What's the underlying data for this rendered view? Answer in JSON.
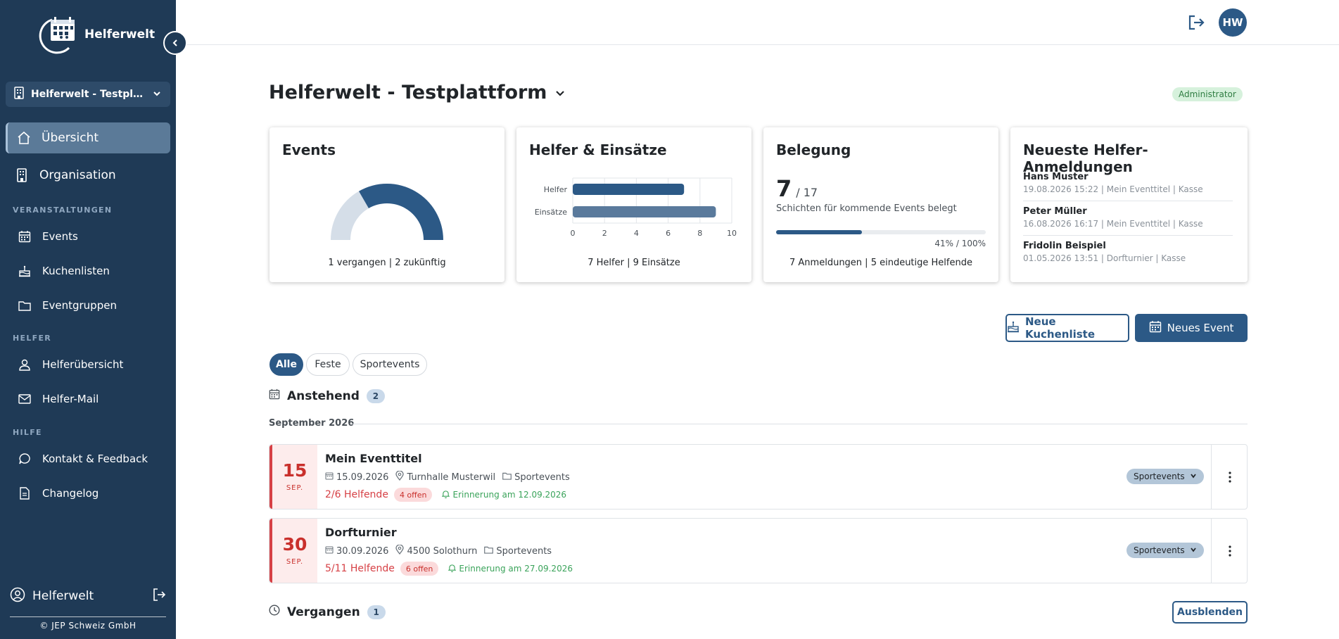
{
  "app": {
    "brand": "Helferwelt",
    "org_name": "Helferwelt - Testplatt...",
    "copyright": "© JEP Schweiz GmbH"
  },
  "sidebar": {
    "main": [
      {
        "label": "Übersicht",
        "icon": "home-icon"
      },
      {
        "label": "Organisation",
        "icon": "building-icon"
      }
    ],
    "sections": [
      {
        "title": "VERANSTALTUNGEN",
        "items": [
          {
            "label": "Events",
            "icon": "calendar-icon"
          },
          {
            "label": "Kuchenlisten",
            "icon": "cake-icon"
          },
          {
            "label": "Eventgruppen",
            "icon": "folder-icon"
          }
        ]
      },
      {
        "title": "HELFER",
        "items": [
          {
            "label": "Helferübersicht",
            "icon": "user-icon"
          },
          {
            "label": "Helfer-Mail",
            "icon": "mail-icon"
          }
        ]
      },
      {
        "title": "HILFE",
        "items": [
          {
            "label": "Kontakt & Feedback",
            "icon": "chat-icon"
          },
          {
            "label": "Changelog",
            "icon": "document-icon"
          }
        ]
      }
    ],
    "footer_user": "Helferwelt"
  },
  "topbar": {
    "avatar_initials": "HW"
  },
  "page": {
    "title": "Helferwelt - Testplattform",
    "role": "Administrator"
  },
  "cards": {
    "events": {
      "title": "Events",
      "footer": "1 vergangen | 2 zukünftig",
      "chart_data": {
        "type": "pie",
        "categories": [
          "vergangen",
          "zukünftig"
        ],
        "values": [
          1,
          2
        ]
      }
    },
    "helpers": {
      "title": "Helfer & Einsätze",
      "footer": "7 Helfer | 9 Einsätze",
      "chart_data": {
        "type": "bar",
        "orientation": "horizontal",
        "categories": [
          "Helfer",
          "Einsätze"
        ],
        "values": [
          7,
          9
        ],
        "xlim": [
          0,
          10
        ],
        "ticks": [
          "0",
          "2",
          "4",
          "6",
          "8",
          "10"
        ],
        "colors": [
          "#2c5986",
          "#5a7a9c"
        ],
        "grid": true
      }
    },
    "occupancy": {
      "title": "Belegung",
      "filled": "7",
      "total": "/ 17",
      "subtitle": "Schichten für kommende Events belegt",
      "percent_label": "41% / 100%",
      "percent": 41,
      "footer": "7 Anmeldungen | 5 eindeutige Helfende"
    },
    "registrations": {
      "title": "Neueste Helfer-Anmeldungen",
      "items": [
        {
          "name": "Hans Muster",
          "meta": "19.08.2026 15:22 | Mein Eventtitel | Kasse"
        },
        {
          "name": "Peter Müller",
          "meta": "16.08.2026 16:17 | Mein Eventtitel | Kasse"
        },
        {
          "name": "Fridolin Beispiel",
          "meta": "01.05.2026 13:51 | Dorfturnier | Kasse"
        }
      ]
    }
  },
  "actions": {
    "new_cake_list": "Neue Kuchenliste",
    "new_event": "Neues Event"
  },
  "filters": [
    "Alle",
    "Feste",
    "Sportevents"
  ],
  "upcoming": {
    "title": "Anstehend",
    "count": "2",
    "month": "September 2026",
    "events": [
      {
        "day": "15",
        "month": "SEP.",
        "title": "Mein Eventtitel",
        "date": "15.09.2026",
        "location": "Turnhalle Musterwil",
        "group": "Sportevents",
        "helpers": "2/6 Helfende",
        "open": "4 offen",
        "reminder": "Erinnerung am 12.09.2026",
        "select": "Sportevents"
      },
      {
        "day": "30",
        "month": "SEP.",
        "title": "Dorfturnier",
        "date": "30.09.2026",
        "location": "4500 Solothurn",
        "group": "Sportevents",
        "helpers": "5/11 Helfende",
        "open": "6 offen",
        "reminder": "Erinnerung am 27.09.2026",
        "select": "Sportevents"
      }
    ]
  },
  "past": {
    "title": "Vergangen",
    "count": "1",
    "hide_label": "Ausblenden"
  },
  "colors": {
    "sidebar_bg": "#1f3a56",
    "primary": "#2c5986",
    "danger": "#d64045",
    "success": "#3aa35a"
  }
}
